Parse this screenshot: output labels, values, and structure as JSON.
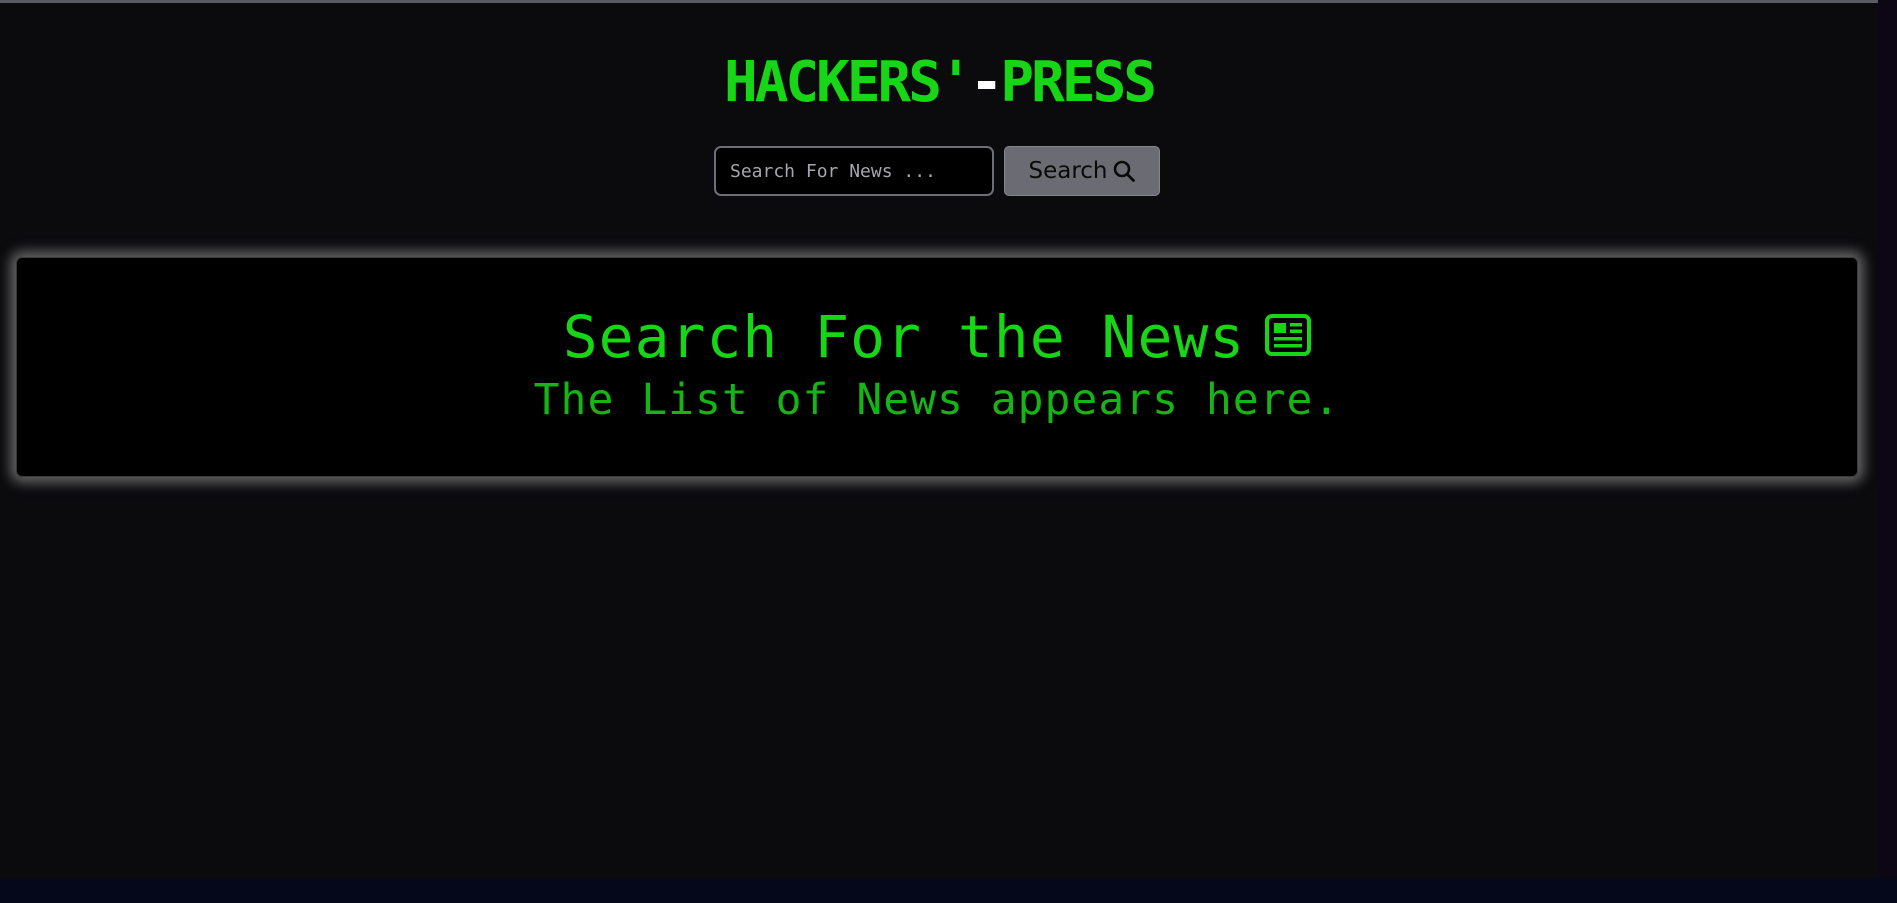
{
  "header": {
    "title_left": "HACKERS'",
    "title_separator": "-",
    "title_right": "PRESS"
  },
  "search": {
    "placeholder": "Search For News ...",
    "value": "",
    "button_label": "Search",
    "button_icon": "search-icon"
  },
  "news_panel": {
    "title": "Search For the News",
    "title_icon": "newspaper-icon",
    "subtitle": "The List of News appears here."
  },
  "colors": {
    "accent_green": "#16d616",
    "subtitle_green": "#15b515",
    "page_background": "#0b0b0e",
    "panel_background": "#000000",
    "button_background": "#6b6b73"
  }
}
